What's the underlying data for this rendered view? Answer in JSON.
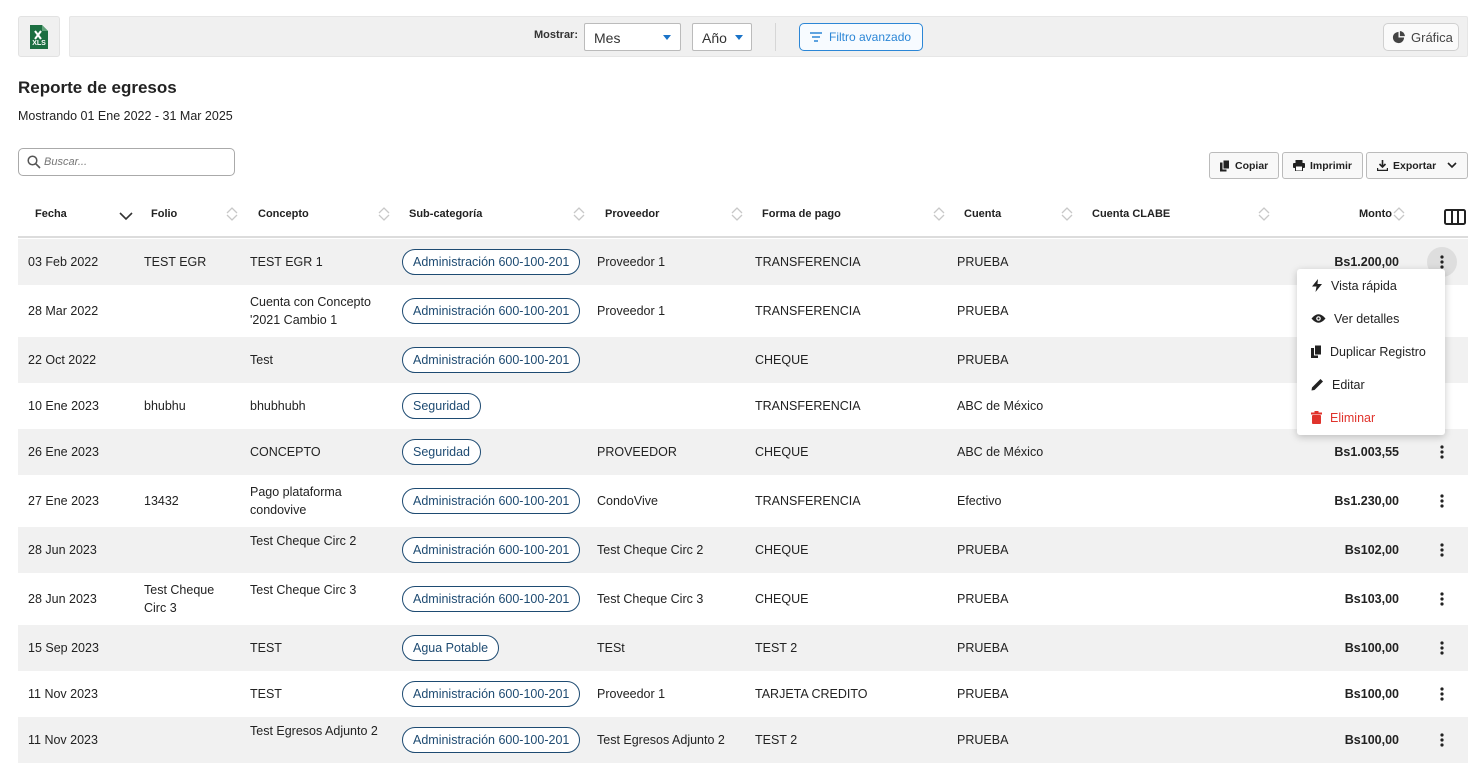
{
  "toolbar": {
    "excel_label": "XLS",
    "show_label": "Mostrar:",
    "period_select": "Mes",
    "year_select": "Año",
    "advanced_filter": "Filtro avanzado",
    "chart_button": "Gráfica"
  },
  "report": {
    "title": "Reporte de egresos",
    "range": "Mostrando 01 Ene 2022 - 31 Mar 2025"
  },
  "search": {
    "placeholder": "Buscar..."
  },
  "actions": {
    "copy": "Copiar",
    "print": "Imprimir",
    "export": "Exportar"
  },
  "columns": {
    "fecha": "Fecha",
    "folio": "Folio",
    "concepto": "Concepto",
    "subcategoria": "Sub-categoría",
    "proveedor": "Proveedor",
    "forma_pago": "Forma de pago",
    "cuenta": "Cuenta",
    "cuenta_clabe": "Cuenta CLABE",
    "monto": "Monto"
  },
  "rows": [
    {
      "fecha": "03 Feb 2022",
      "folio": "TEST EGR",
      "concepto": "TEST EGR 1",
      "sub": "Administración 600-100-201",
      "proveedor": "Proveedor 1",
      "forma": "TRANSFERENCIA",
      "cuenta": "PRUEBA",
      "monto": "Bs1.200,00"
    },
    {
      "fecha": "28 Mar 2022",
      "folio": "",
      "concepto": "Cuenta con Concepto '2021 Cambio 1",
      "sub": "Administración 600-100-201",
      "proveedor": "Proveedor 1",
      "forma": "TRANSFERENCIA",
      "cuenta": "PRUEBA",
      "monto": ""
    },
    {
      "fecha": "22 Oct 2022",
      "folio": "",
      "concepto": "Test",
      "sub": "Administración 600-100-201",
      "proveedor": "",
      "forma": "CHEQUE",
      "cuenta": "PRUEBA",
      "monto": ""
    },
    {
      "fecha": "10 Ene 2023",
      "folio": "bhubhu",
      "concepto": "bhubhubh",
      "sub": "Seguridad",
      "proveedor": "",
      "forma": "TRANSFERENCIA",
      "cuenta": "ABC de México",
      "monto": ""
    },
    {
      "fecha": "26 Ene 2023",
      "folio": "",
      "concepto": "CONCEPTO",
      "sub": "Seguridad",
      "proveedor": "PROVEEDOR",
      "forma": "CHEQUE",
      "cuenta": "ABC de México",
      "monto": "Bs1.003,55"
    },
    {
      "fecha": "27 Ene 2023",
      "folio": "13432",
      "concepto": "Pago plataforma condovive",
      "sub": "Administración 600-100-201",
      "proveedor": "CondoVive",
      "forma": "TRANSFERENCIA",
      "cuenta": "Efectivo",
      "monto": "Bs1.230,00"
    },
    {
      "fecha": "28 Jun 2023",
      "folio": "",
      "concepto": "Test Cheque Circ 2",
      "sub": "Administración 600-100-201",
      "proveedor": "Test Cheque Circ 2",
      "forma": "CHEQUE",
      "cuenta": "PRUEBA",
      "monto": "Bs102,00"
    },
    {
      "fecha": "28 Jun 2023",
      "folio": "Test Cheque Circ 3",
      "concepto": "Test Cheque Circ 3",
      "sub": "Administración 600-100-201",
      "proveedor": "Test Cheque Circ 3",
      "forma": "CHEQUE",
      "cuenta": "PRUEBA",
      "monto": "Bs103,00"
    },
    {
      "fecha": "15 Sep 2023",
      "folio": "",
      "concepto": "TEST",
      "sub": "Agua Potable",
      "proveedor": "TESt",
      "forma": "TEST 2",
      "cuenta": "PRUEBA",
      "monto": "Bs100,00"
    },
    {
      "fecha": "11 Nov 2023",
      "folio": "",
      "concepto": "TEST",
      "sub": "Administración 600-100-201",
      "proveedor": "Proveedor 1",
      "forma": "TARJETA CREDITO",
      "cuenta": "PRUEBA",
      "monto": "Bs100,00"
    },
    {
      "fecha": "11 Nov 2023",
      "folio": "",
      "concepto": "Test Egresos Adjunto 2",
      "sub": "Administración 600-100-201",
      "proveedor": "Test Egresos Adjunto 2",
      "forma": "TEST 2",
      "cuenta": "PRUEBA",
      "monto": "Bs100,00"
    }
  ],
  "context_menu": {
    "quick_view": "Vista rápida",
    "details": "Ver detalles",
    "duplicate": "Duplicar Registro",
    "edit": "Editar",
    "delete": "Eliminar"
  },
  "colors": {
    "accent": "#2b86d6",
    "badge": "#1e4b72",
    "danger": "#e0332c",
    "excel": "#1d6f42"
  }
}
